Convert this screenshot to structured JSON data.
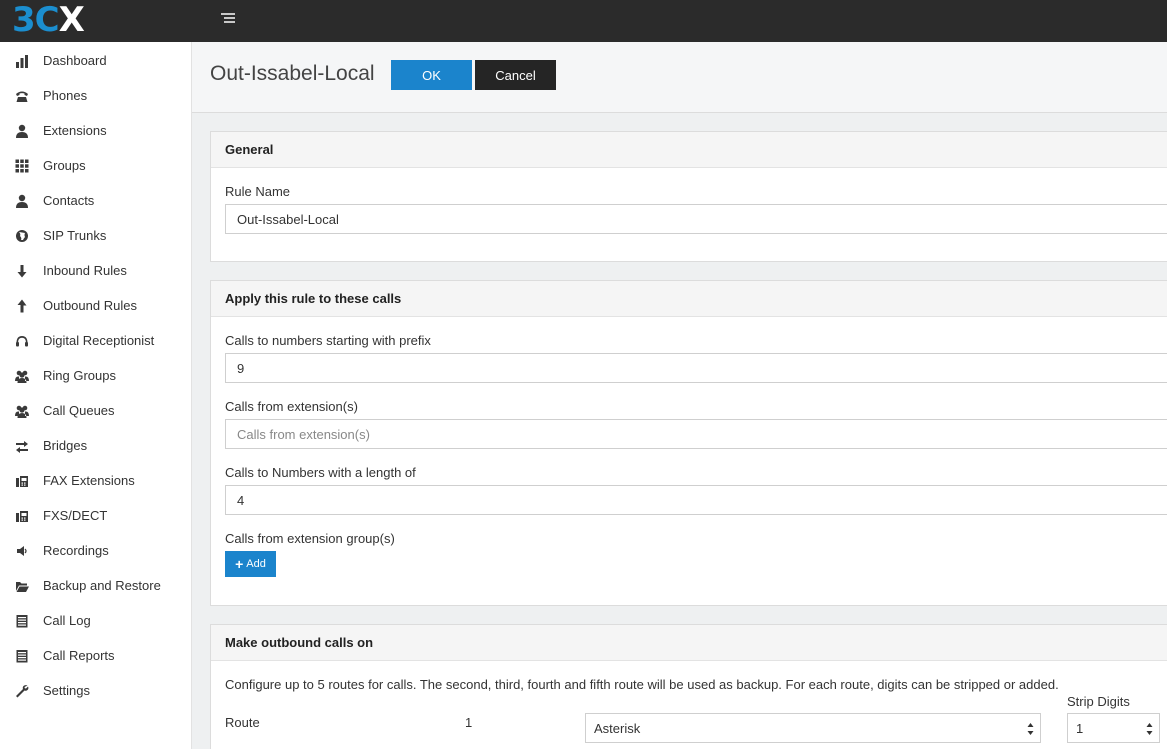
{
  "app": {
    "logo_part1": "3C",
    "logo_part2": "X"
  },
  "sidebar": {
    "items": [
      {
        "label": "Dashboard",
        "icon": "bar-chart-icon"
      },
      {
        "label": "Phones",
        "icon": "phone-icon"
      },
      {
        "label": "Extensions",
        "icon": "user-icon"
      },
      {
        "label": "Groups",
        "icon": "grid-icon"
      },
      {
        "label": "Contacts",
        "icon": "user-icon"
      },
      {
        "label": "SIP Trunks",
        "icon": "globe-icon"
      },
      {
        "label": "Inbound Rules",
        "icon": "arrow-down-icon"
      },
      {
        "label": "Outbound Rules",
        "icon": "arrow-up-icon"
      },
      {
        "label": "Digital Receptionist",
        "icon": "headset-icon"
      },
      {
        "label": "Ring Groups",
        "icon": "users-icon"
      },
      {
        "label": "Call Queues",
        "icon": "users-icon"
      },
      {
        "label": "Bridges",
        "icon": "exchange-icon"
      },
      {
        "label": "FAX Extensions",
        "icon": "fax-icon"
      },
      {
        "label": "FXS/DECT",
        "icon": "fax-icon"
      },
      {
        "label": "Recordings",
        "icon": "speaker-icon"
      },
      {
        "label": "Backup and Restore",
        "icon": "folder-open-icon"
      },
      {
        "label": "Call Log",
        "icon": "list-icon"
      },
      {
        "label": "Call Reports",
        "icon": "list-icon"
      },
      {
        "label": "Settings",
        "icon": "wrench-icon"
      }
    ]
  },
  "header": {
    "title": "Out-Issabel-Local",
    "ok_label": "OK",
    "cancel_label": "Cancel"
  },
  "general": {
    "heading": "General",
    "rule_name_label": "Rule Name",
    "rule_name_value": "Out-Issabel-Local"
  },
  "apply": {
    "heading": "Apply this rule to these calls",
    "prefix_label": "Calls to numbers starting with prefix",
    "prefix_value": "9",
    "from_ext_label": "Calls from extension(s)",
    "from_ext_value": "",
    "from_ext_placeholder": "Calls from extension(s)",
    "length_label": "Calls to Numbers with a length of",
    "length_value": "4",
    "groups_label": "Calls from extension group(s)",
    "add_label": "Add"
  },
  "outbound": {
    "heading": "Make outbound calls on",
    "description": "Configure up to 5 routes for calls. The second, third, fourth and fifth route will be used as backup. For each route, digits can be stripped or added.",
    "strip_digits_label": "Strip Digits",
    "route_label": "Route",
    "route_number": "1",
    "route_selected": "Asterisk",
    "strip_selected": "1"
  }
}
